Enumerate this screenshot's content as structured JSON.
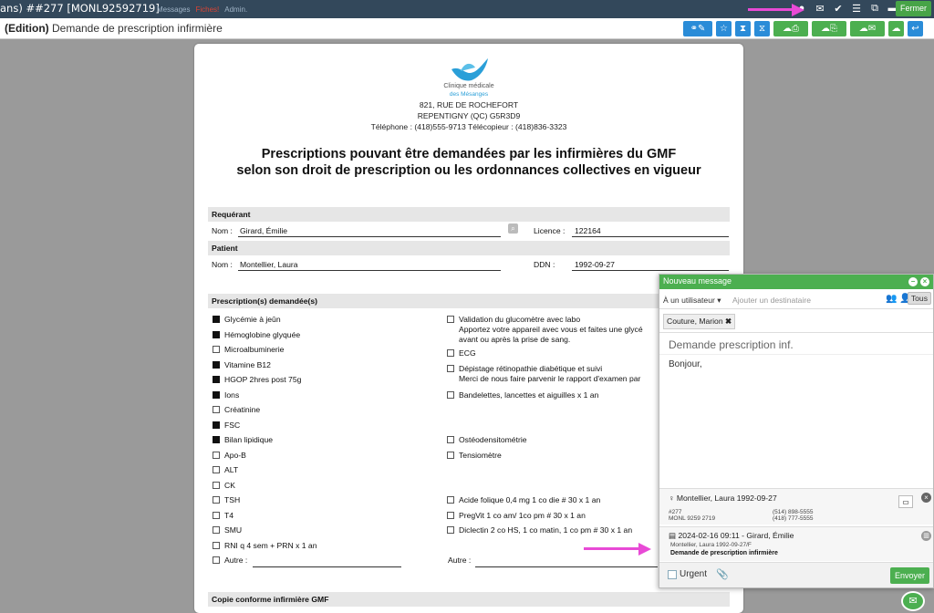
{
  "window": {
    "title": "ans) ##277 [MONL92592719]",
    "faded_menu": [
      "…",
      "Messages",
      "Fiches!",
      "Admin."
    ],
    "close_label": "Fermer"
  },
  "titlebar": {
    "mode": "(Edition)",
    "title": "Demande de prescription infirmière"
  },
  "clinic": {
    "name_line1": "Clinique médicale",
    "name_line2": "des Mésanges",
    "address1": "821, RUE DE ROCHEFORT",
    "address2": "REPENTIGNY (QC) G5R3D9",
    "phone_line": "Téléphone : (418)555-9713   Télécopieur : (418)836-3323"
  },
  "document": {
    "title_line1": "Prescriptions pouvant être demandées par les infirmières du GMF",
    "title_line2": "selon son droit de prescription ou les ordonnances collectives en vigueur"
  },
  "requerant": {
    "section": "Requérant",
    "nom_label": "Nom :",
    "nom": "Girard, Émilie",
    "licence_label": "Licence :",
    "licence": "122164"
  },
  "patient": {
    "section": "Patient",
    "nom_label": "Nom :",
    "nom": "Montellier, Laura",
    "ddn_label": "DDN :",
    "ddn": "1992-09-27"
  },
  "prescriptions": {
    "section": "Prescription(s) demandée(s)",
    "left": [
      {
        "label": "Glycémie à jeûn",
        "checked": true
      },
      {
        "label": "Hémoglobine glyquée",
        "checked": true
      },
      {
        "label": "Microalbuminerie",
        "checked": false
      },
      {
        "label": "Vitamine B12",
        "checked": true
      },
      {
        "label": "HGOP 2hres post 75g",
        "checked": true
      },
      {
        "label": "Ions",
        "checked": true
      },
      {
        "label": "Créatinine",
        "checked": false
      },
      {
        "label": "FSC",
        "checked": true
      },
      {
        "label": "Bilan lipidique",
        "checked": true
      },
      {
        "label": "Apo-B",
        "checked": false
      },
      {
        "label": "ALT",
        "checked": false
      },
      {
        "label": "CK",
        "checked": false
      },
      {
        "label": "TSH",
        "checked": false
      },
      {
        "label": "T4",
        "checked": false
      },
      {
        "label": "SMU",
        "checked": false
      },
      {
        "label": "RNI q 4 sem + PRN x 1 an",
        "checked": false
      },
      {
        "label": "Autre :",
        "checked": false
      }
    ],
    "right": [
      {
        "label": "Validation du glucomètre avec labo",
        "sub1": "Apportez votre appareil avec vous et faites une glycé",
        "sub2": "avant ou après la prise de sang.",
        "checked": false
      },
      {
        "label": "ECG",
        "checked": false
      },
      {
        "label": "Dépistage rétinopathie diabétique et suivi",
        "sub1": "Merci de nous faire parvenir le rapport d'examen par",
        "checked": false
      },
      {
        "label": "Bandelettes, lancettes et aiguilles x 1 an",
        "checked": false
      },
      {
        "label": "Ostéodensitométrie",
        "checked": false
      },
      {
        "label": "Tensiomètre",
        "checked": false
      },
      {
        "label": "Acide folique 0,4 mg 1 co die # 30 x 1 an",
        "checked": false
      },
      {
        "label": "PregVit 1 co am/ 1co pm # 30 x 1 an",
        "checked": false
      },
      {
        "label": "Diclectin 2 co HS, 1 co matin, 1 co pm # 30 x 1 an",
        "checked": false
      }
    ],
    "autre_right": "Autre :"
  },
  "copie_section": "Copie conforme infirmière GMF",
  "message_panel": {
    "title": "Nouveau message",
    "recipient_type": "À un utilisateur",
    "recipient_placeholder": "Ajouter un destinataire",
    "tous_label": "Tous",
    "recipient_chip": "Couture, Marion",
    "subject": "Demande prescription inf.",
    "body": "Bonjour,",
    "attach_patient": {
      "name": "Montellier, Laura 1992-09-27",
      "line1": "#277",
      "line2": "MONL 9259 2719",
      "phone1": "(514) 898-5555",
      "phone2": "(418) 777-5555"
    },
    "attach_doc": {
      "datetime": "2024-02-16 09:11 - Girard, Émilie",
      "sub": "Montellier, Laura 1992-09-27/F",
      "title": "Demande de prescription infirmière"
    },
    "urgent_label": "Urgent",
    "send_label": "Envoyer"
  },
  "colors": {
    "green": "#4caf50",
    "blue": "#2a8cd8",
    "arrow": "#e84ad6",
    "topbar": "#33485b"
  }
}
